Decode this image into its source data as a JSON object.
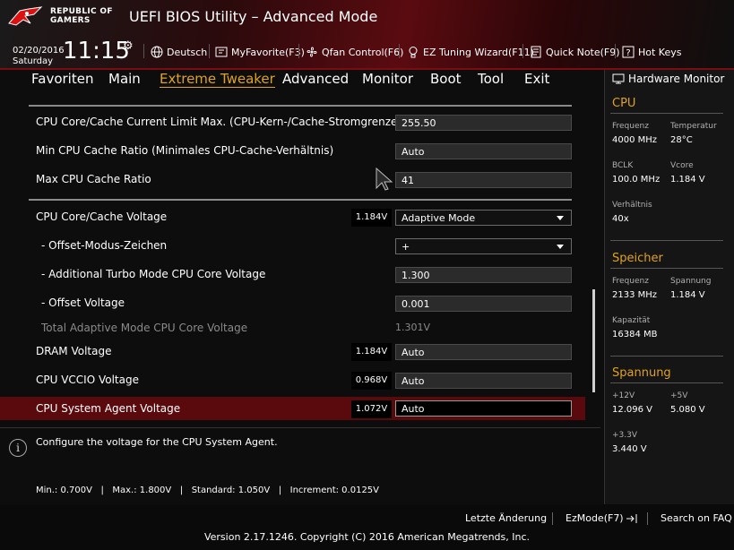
{
  "header": {
    "brand_line1": "REPUBLIC OF",
    "brand_line2": "GAMERS",
    "title": "UEFI BIOS Utility – Advanced Mode",
    "date": "02/20/2016",
    "weekday": "Saturday",
    "time": "11:15",
    "toolbar": [
      {
        "label": "Deutsch",
        "icon": "globe-icon"
      },
      {
        "label": "MyFavorite(F3)",
        "icon": "favorite-icon"
      },
      {
        "label": "Qfan Control(F6)",
        "icon": "fan-icon"
      },
      {
        "label": "EZ Tuning Wizard(F11)",
        "icon": "bulb-icon"
      },
      {
        "label": "Quick Note(F9)",
        "icon": "note-icon"
      },
      {
        "label": "Hot Keys",
        "icon": "help-icon"
      }
    ]
  },
  "nav": {
    "tabs": [
      "Favoriten",
      "Main",
      "Extreme Tweaker",
      "Advanced",
      "Monitor",
      "Boot",
      "Tool",
      "Exit"
    ],
    "active": "Extreme Tweaker"
  },
  "settings": [
    {
      "label": "CPU Core/Cache Current Limit Max. (CPU-Kern-/Cache-Stromgrenze max.)",
      "value": "255.50"
    },
    {
      "label": "Min CPU Cache Ratio (Minimales CPU-Cache-Verhältnis)",
      "value": "Auto"
    },
    {
      "label": "Max CPU Cache Ratio",
      "value": "41"
    },
    {
      "label": "CPU Core/Cache Voltage",
      "reading": "1.184V",
      "value": "Adaptive Mode"
    },
    {
      "label": "- Offset-Modus-Zeichen",
      "value": "+"
    },
    {
      "label": "- Additional Turbo Mode CPU Core Voltage",
      "value": "1.300"
    },
    {
      "label": "- Offset Voltage",
      "value": "0.001"
    },
    {
      "label": "Total Adaptive Mode CPU Core Voltage",
      "value": "1.301V"
    },
    {
      "label": "DRAM Voltage",
      "reading": "1.184V",
      "value": "Auto"
    },
    {
      "label": "CPU VCCIO Voltage",
      "reading": "0.968V",
      "value": "Auto"
    },
    {
      "label": "CPU System Agent Voltage",
      "reading": "1.072V",
      "value": "Auto"
    }
  ],
  "help_text": "Configure the voltage for the CPU System Agent.",
  "limits_text": "Min.: 0.700V   |   Max.: 1.800V   |   Standard: 1.050V   |   Increment: 0.0125V",
  "hw_monitor": {
    "title": "Hardware Monitor",
    "cpu": {
      "heading": "CPU",
      "freq_label": "Frequenz",
      "freq": "4000 MHz",
      "temp_label": "Temperatur",
      "temp": "28°C",
      "bclk_label": "BCLK",
      "bclk": "100.0 MHz",
      "vcore_label": "Vcore",
      "vcore": "1.184 V",
      "ratio_label": "Verhältnis",
      "ratio": "40x"
    },
    "memory": {
      "heading": "Speicher",
      "freq_label": "Frequenz",
      "freq": "2133 MHz",
      "volt_label": "Spannung",
      "volt": "1.184 V",
      "cap_label": "Kapazität",
      "cap": "16384 MB"
    },
    "voltage": {
      "heading": "Spannung",
      "v12_label": "+12V",
      "v12": "12.096 V",
      "v5_label": "+5V",
      "v5": "5.080 V",
      "v33_label": "+3.3V",
      "v33": "3.440 V"
    }
  },
  "footer": {
    "last_change": "Letzte Änderung",
    "ezmode": "EzMode(F7)",
    "search": "Search on FAQ",
    "version": "Version 2.17.1246. Copyright (C) 2016 American Megatrends, Inc."
  },
  "colors": {
    "accent": "#e0a21e",
    "highlight": "#5a0a0d"
  }
}
